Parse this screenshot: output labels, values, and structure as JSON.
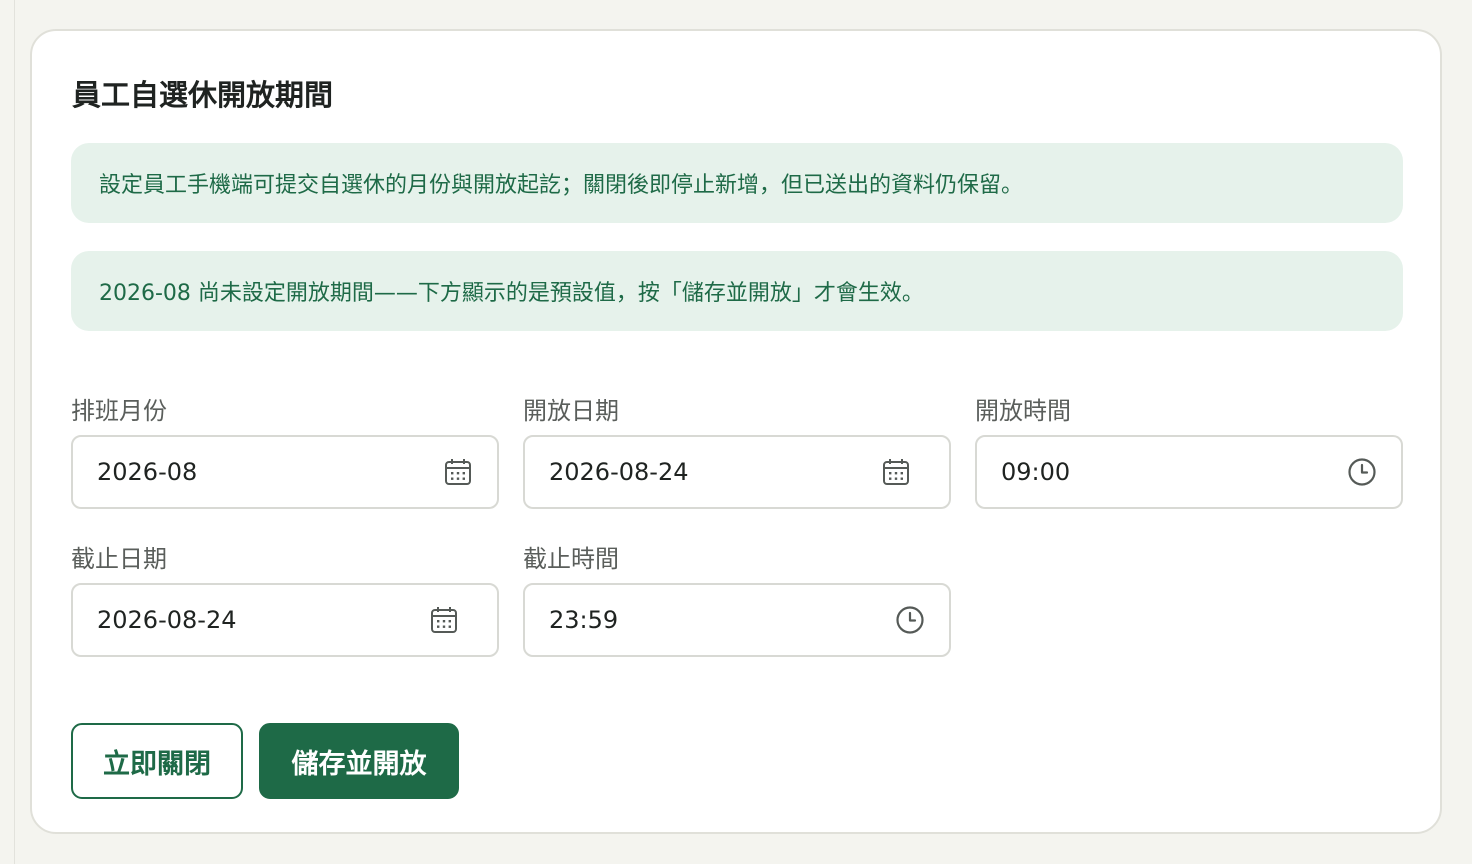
{
  "card": {
    "title": "員工自選休開放期間",
    "info_notice": "設定員工手機端可提交自選休的月份與開放起訖；關閉後即停止新增，但已送出的資料仍保留。",
    "warning_notice": "2026-08 尚未設定開放期間——下方顯示的是預設值，按「儲存並開放」才會生效。"
  },
  "form": {
    "schedule_month": {
      "label": "排班月份",
      "value": "2026-08",
      "icon": "calendar-icon"
    },
    "open_date": {
      "label": "開放日期",
      "value": "2026-08-24",
      "icon": "calendar-icon"
    },
    "open_time": {
      "label": "開放時間",
      "value": "09:00",
      "icon": "clock-icon"
    },
    "close_date": {
      "label": "截止日期",
      "value": "2026-08-24",
      "icon": "calendar-icon"
    },
    "close_time": {
      "label": "截止時間",
      "value": "23:59",
      "icon": "clock-icon"
    }
  },
  "actions": {
    "close_now": "立即關閉",
    "save_and_open": "儲存並開放"
  },
  "colors": {
    "accent": "#1e6a47",
    "notice_background": "#e6f2eb",
    "page_background": "#f4f4ef"
  }
}
